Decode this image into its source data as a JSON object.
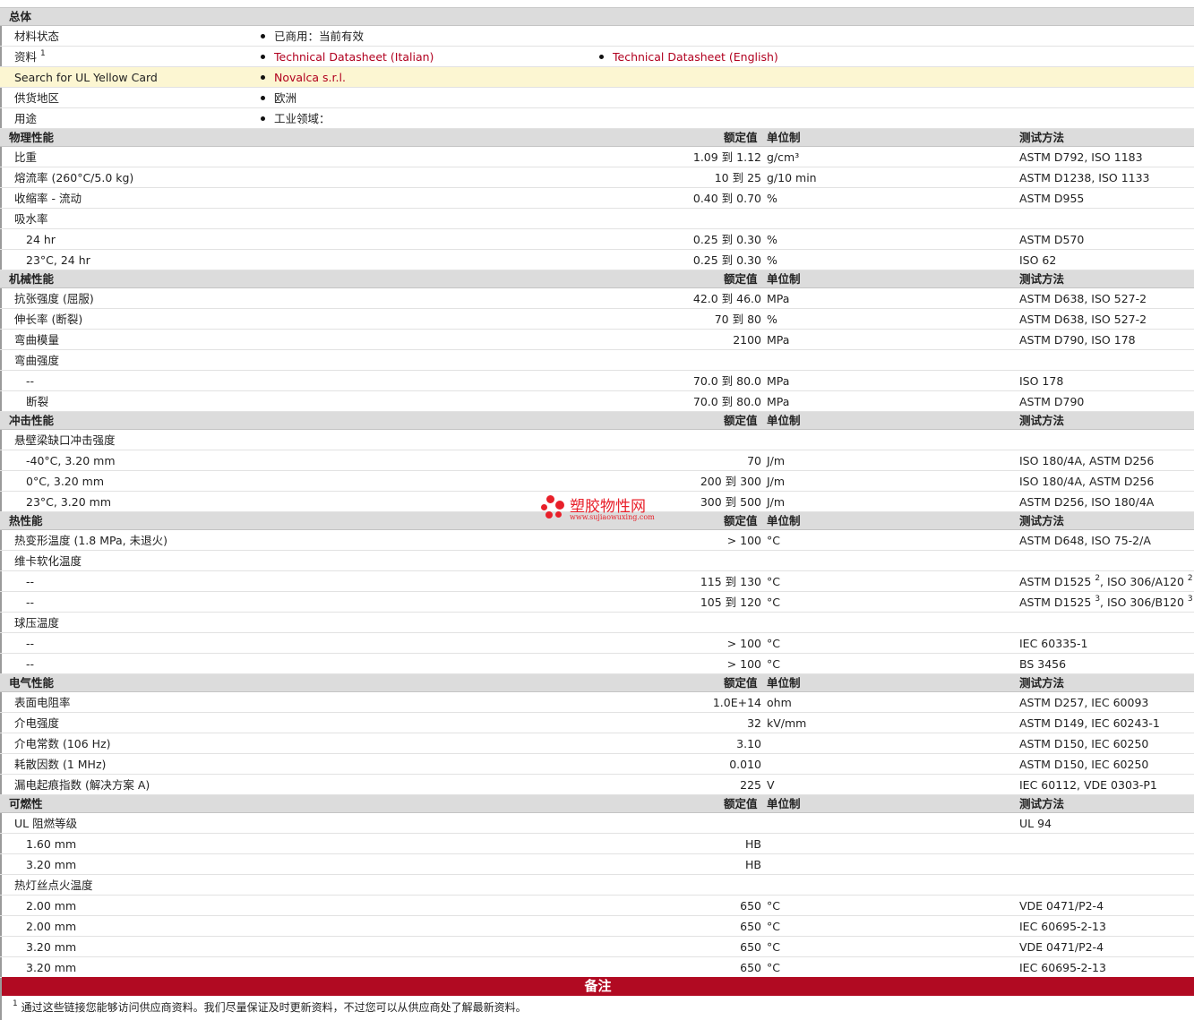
{
  "general": {
    "header": "总体",
    "rows": [
      {
        "label": "材料状态",
        "items": [
          {
            "text": "已商用：当前有效",
            "link": false
          }
        ]
      },
      {
        "label": "资料",
        "sup": "1",
        "items": [
          {
            "text": "Technical Datasheet (Italian)",
            "link": true
          },
          {
            "text": "Technical Datasheet (English)",
            "link": true
          }
        ]
      },
      {
        "label": "Search for UL Yellow Card",
        "highlight": true,
        "items": [
          {
            "text": "Novalca s.r.l.",
            "link": true
          }
        ]
      },
      {
        "label": "供货地区",
        "items": [
          {
            "text": "欧洲",
            "link": false
          }
        ]
      },
      {
        "label": "用途",
        "items": [
          {
            "text": "工业领域：",
            "link": false
          }
        ]
      }
    ]
  },
  "column_headers": {
    "value": "额定值",
    "unit": "单位制",
    "method": "测试方法"
  },
  "sections": [
    {
      "title": "物理性能",
      "rows": [
        {
          "label": "比重",
          "value": "1.09 到  1.12",
          "unit": "g/cm³",
          "method": "ASTM D792, ISO 1183"
        },
        {
          "label": "熔流率  (260°C/5.0 kg)",
          "value": "10 到  25",
          "unit": "g/10 min",
          "method": "ASTM D1238, ISO 1133"
        },
        {
          "label": "收缩率  - 流动",
          "value": "0.40 到  0.70",
          "unit": "%",
          "method": "ASTM D955"
        },
        {
          "label": "吸水率",
          "value": "",
          "unit": "",
          "method": ""
        },
        {
          "label": "24 hr",
          "sub": true,
          "value": "0.25 到  0.30",
          "unit": "%",
          "method": "ASTM D570"
        },
        {
          "label": "23°C, 24 hr",
          "sub": true,
          "value": "0.25 到  0.30",
          "unit": "%",
          "method": "ISO 62"
        }
      ]
    },
    {
      "title": "机械性能",
      "rows": [
        {
          "label": "抗张强度  (屈服)",
          "value": "42.0 到  46.0",
          "unit": "MPa",
          "method": "ASTM D638, ISO 527-2"
        },
        {
          "label": "伸长率  (断裂)",
          "value": "70 到  80",
          "unit": "%",
          "method": "ASTM D638, ISO 527-2"
        },
        {
          "label": "弯曲模量",
          "value": "2100",
          "unit": "MPa",
          "method": "ASTM D790, ISO 178"
        },
        {
          "label": "弯曲强度",
          "value": "",
          "unit": "",
          "method": ""
        },
        {
          "label": "--",
          "sub": true,
          "value": "70.0 到  80.0",
          "unit": "MPa",
          "method": "ISO 178"
        },
        {
          "label": "断裂",
          "sub": true,
          "value": "70.0 到  80.0",
          "unit": "MPa",
          "method": "ASTM D790"
        }
      ]
    },
    {
      "title": "冲击性能",
      "rows": [
        {
          "label": "悬壁梁缺口冲击强度",
          "value": "",
          "unit": "",
          "method": ""
        },
        {
          "label": "-40°C, 3.20 mm",
          "sub": true,
          "value": "70",
          "unit": "J/m",
          "method": "ISO 180/4A, ASTM D256"
        },
        {
          "label": "0°C, 3.20 mm",
          "sub": true,
          "value": "200 到  300",
          "unit": "J/m",
          "method": "ISO 180/4A, ASTM D256"
        },
        {
          "label": "23°C, 3.20 mm",
          "sub": true,
          "value": "300 到  500",
          "unit": "J/m",
          "method": "ASTM D256, ISO 180/4A"
        }
      ]
    },
    {
      "title": "热性能",
      "rows": [
        {
          "label": "热变形温度  (1.8 MPa, 未退火)",
          "value": "> 100",
          "unit": "°C",
          "method": "ASTM D648, ISO 75-2/A"
        },
        {
          "label": "维卡软化温度",
          "value": "",
          "unit": "",
          "method": ""
        },
        {
          "label": "--",
          "sub": true,
          "value": "115 到  130",
          "unit": "°C",
          "method": "ASTM D1525",
          "method_sup": "2",
          "method2": ", ISO 306/A120",
          "method2_sup": "2"
        },
        {
          "label": "--",
          "sub": true,
          "value": "105 到  120",
          "unit": "°C",
          "method": "ASTM D1525",
          "method_sup": "3",
          "method2": ", ISO 306/B120",
          "method2_sup": "3"
        },
        {
          "label": "球压温度",
          "value": "",
          "unit": "",
          "method": ""
        },
        {
          "label": "--",
          "sub": true,
          "value": "> 100",
          "unit": "°C",
          "method": "IEC 60335-1"
        },
        {
          "label": "--",
          "sub": true,
          "value": "> 100",
          "unit": "°C",
          "method": "BS 3456"
        }
      ]
    },
    {
      "title": "电气性能",
      "rows": [
        {
          "label": "表面电阻率",
          "value": "1.0E+14",
          "unit": "ohm",
          "method": "ASTM D257, IEC 60093"
        },
        {
          "label": "介电强度",
          "value": "32",
          "unit": "kV/mm",
          "method": "ASTM D149, IEC 60243-1"
        },
        {
          "label": "介电常数  (106 Hz)",
          "value": "3.10",
          "unit": "",
          "method": "ASTM D150, IEC 60250"
        },
        {
          "label": "耗散因数  (1 MHz)",
          "value": "0.010",
          "unit": "",
          "method": "ASTM D150, IEC 60250"
        },
        {
          "label": "漏电起痕指数  (解决方案  A)",
          "value": "225",
          "unit": "V",
          "method": "IEC 60112, VDE 0303-P1"
        }
      ]
    },
    {
      "title": "可燃性",
      "rows": [
        {
          "label": "UL 阻燃等级",
          "value": "",
          "unit": "",
          "method": "UL 94"
        },
        {
          "label": "1.60 mm",
          "sub": true,
          "value": "HB",
          "unit": "",
          "method": ""
        },
        {
          "label": "3.20 mm",
          "sub": true,
          "value": "HB",
          "unit": "",
          "method": ""
        },
        {
          "label": "热灯丝点火温度",
          "value": "",
          "unit": "",
          "method": ""
        },
        {
          "label": "2.00 mm",
          "sub": true,
          "value": "650",
          "unit": "°C",
          "method": "VDE 0471/P2-4"
        },
        {
          "label": "2.00 mm",
          "sub": true,
          "value": "650",
          "unit": "°C",
          "method": "IEC 60695-2-13"
        },
        {
          "label": "3.20 mm",
          "sub": true,
          "value": "650",
          "unit": "°C",
          "method": "VDE 0471/P2-4"
        },
        {
          "label": "3.20 mm",
          "sub": true,
          "value": "650",
          "unit": "°C",
          "method": "IEC 60695-2-13"
        }
      ]
    }
  ],
  "notes": {
    "title": "备注",
    "footnotes": [
      {
        "num": "1",
        "text": "通过这些链接您能够访问供应商资料。我们尽量保证及时更新资料，不过您可以从供应商处了解最新资料。"
      }
    ]
  },
  "watermark": {
    "title": "塑胶物性网",
    "url": "www.sujiaowuxing.com"
  },
  "colors": {
    "link": "#b1001f",
    "notes_bar": "#b10a22",
    "header_bg": "#dcdcdc",
    "highlight_bg": "#fcf6d2",
    "watermark": "#e8202a"
  }
}
